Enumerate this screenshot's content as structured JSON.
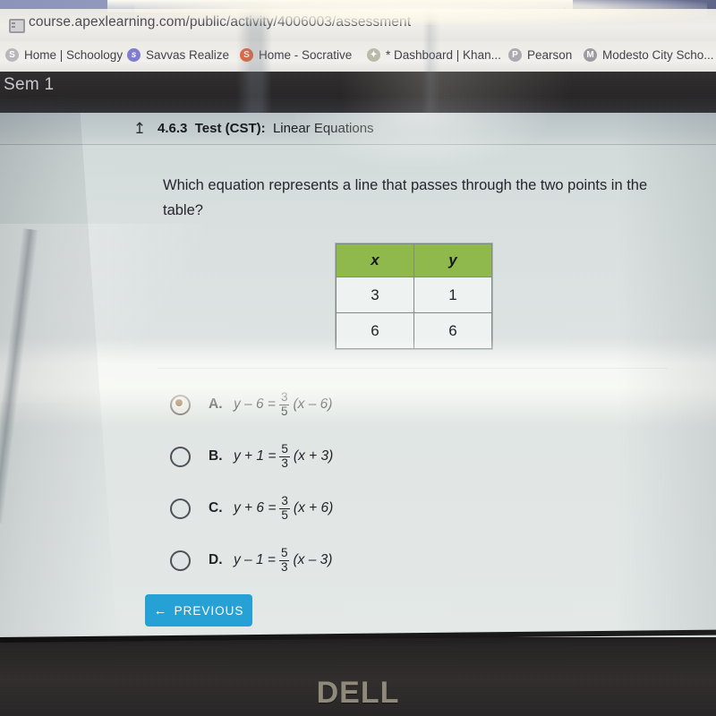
{
  "browser": {
    "url": "course.apexlearning.com/public/activity/4006003/assessment",
    "new_tab_label": "+",
    "bookmarks": [
      {
        "label": "Home | Schoology",
        "icon": "schoology-icon"
      },
      {
        "label": "Savvas Realize",
        "icon": "savvas-icon"
      },
      {
        "label": "Home - Socrative",
        "icon": "socrative-icon"
      },
      {
        "label": "* Dashboard | Khan...",
        "icon": "khan-icon"
      },
      {
        "label": "Pearson",
        "icon": "pearson-icon"
      },
      {
        "label": "Modesto City Scho...",
        "icon": "modesto-icon"
      }
    ]
  },
  "overlay": {
    "course_label": "Sem 1"
  },
  "activity": {
    "number": "4.6.3",
    "type": "Test (CST):",
    "name": "Linear Equations",
    "up_arrow_icon": "↥"
  },
  "question": {
    "text": "Which equation represents a line that passes through the two points in the table?"
  },
  "table": {
    "headers": [
      "x",
      "y"
    ],
    "rows": [
      [
        "3",
        "1"
      ],
      [
        "6",
        "6"
      ]
    ],
    "header_color": "#8fb84a"
  },
  "options": [
    {
      "letter": "A.",
      "selected": true,
      "lhs": "y – 6 =",
      "num": "3",
      "den": "5",
      "rhs": "(x – 6)"
    },
    {
      "letter": "B.",
      "selected": false,
      "lhs": "y + 1 =",
      "num": "5",
      "den": "3",
      "rhs": "(x + 3)"
    },
    {
      "letter": "C.",
      "selected": false,
      "lhs": "y + 6 =",
      "num": "3",
      "den": "5",
      "rhs": "(x + 6)"
    },
    {
      "letter": "D.",
      "selected": false,
      "lhs": "y – 1 =",
      "num": "5",
      "den": "3",
      "rhs": "(x – 3)"
    }
  ],
  "nav": {
    "previous_label": "PREVIOUS",
    "previous_arrow": "←",
    "previous_color": "#24a0d4"
  },
  "hardware": {
    "brand": "DELL"
  }
}
